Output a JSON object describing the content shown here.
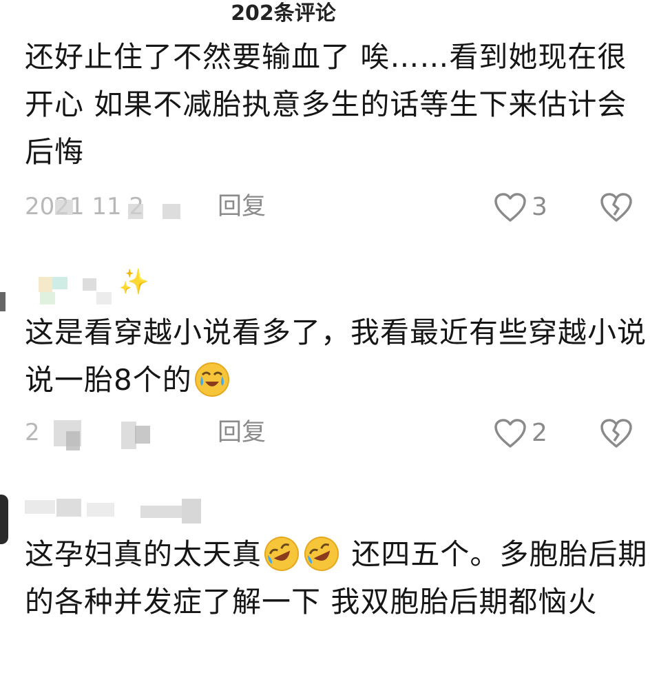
{
  "header": {
    "title": "202条评论"
  },
  "comments": [
    {
      "text": "还好止住了不然要输血了 唉……看到她现在很开心 如果不减胎执意多生的话等生下来估计会后悔",
      "timestamp": "2021 11 2",
      "reply_label": "回复",
      "likes": "3"
    },
    {
      "text_before_emoji": "这是看穿越小说看多了，我看最近有些穿越小说说一胎8个的",
      "timestamp": "2 26",
      "reply_label": "回复",
      "likes": "2",
      "user_emoji": "✨"
    },
    {
      "text_part1": "这孕妇真的太天真",
      "text_part2": " 还四五个。多胞胎后期的各种并发症了解一下 我双胞胎后期都恼火"
    }
  ],
  "icons": {
    "like": "heart-outline-icon",
    "dislike": "broken-heart-icon",
    "emoji_tears_of_joy": "tears-of-joy-emoji-icon",
    "emoji_rofl": "rofl-emoji-icon",
    "sparkle": "sparkle-icon"
  },
  "colors": {
    "text": "#161616",
    "meta": "#8a8a8a",
    "timestamp": "#b8b8b8",
    "emoji_yellow": "#f7c53a"
  }
}
